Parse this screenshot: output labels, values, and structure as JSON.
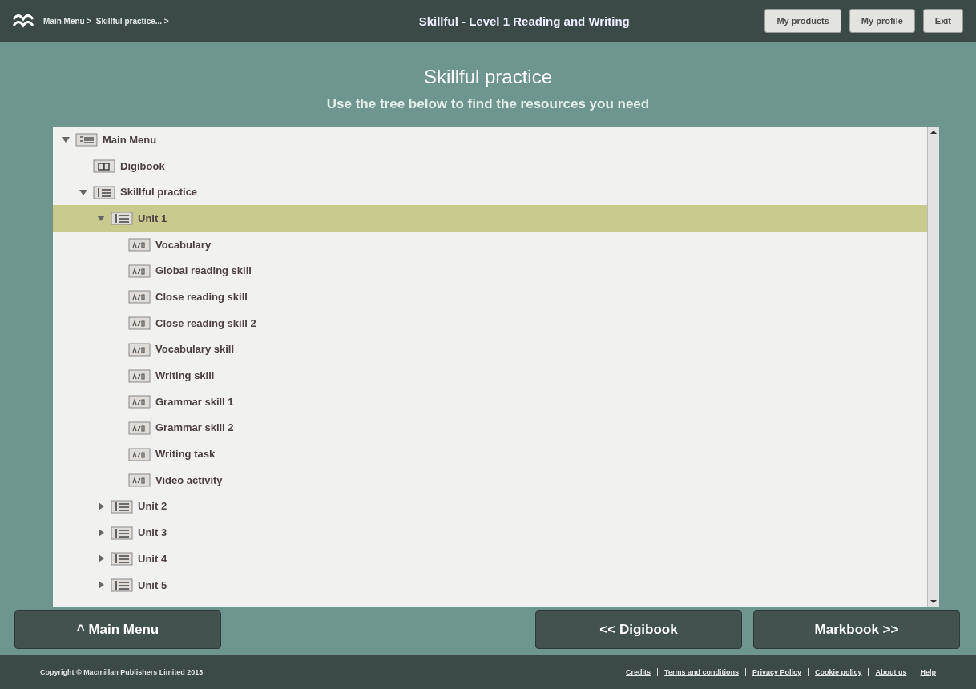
{
  "header": {
    "breadcrumb": "Main Menu >  Skillful practice... >",
    "title": "Skillful - Level 1 Reading and Writing",
    "buttons": [
      "My products",
      "My profile",
      "Exit"
    ]
  },
  "page": {
    "title": "Skillful practice",
    "subtitle": "Use the tree below to find the resources you need"
  },
  "tree": [
    {
      "label": "Main Menu",
      "kind": "menu",
      "expanded": true,
      "selected": false,
      "children": [
        {
          "label": "Digibook",
          "kind": "book",
          "selected": false
        },
        {
          "label": "Skillful practice",
          "kind": "list",
          "expanded": true,
          "selected": false,
          "children": [
            {
              "label": "Unit 1",
              "kind": "list",
              "expanded": true,
              "selected": true,
              "children": [
                {
                  "label": "Vocabulary",
                  "kind": "activity",
                  "selected": false
                },
                {
                  "label": "Global reading skill",
                  "kind": "activity",
                  "selected": false
                },
                {
                  "label": "Close reading skill",
                  "kind": "activity",
                  "selected": false
                },
                {
                  "label": "Close reading skill 2",
                  "kind": "activity",
                  "selected": false
                },
                {
                  "label": "Vocabulary skill",
                  "kind": "activity",
                  "selected": false
                },
                {
                  "label": "Writing skill",
                  "kind": "activity",
                  "selected": false
                },
                {
                  "label": "Grammar skill 1",
                  "kind": "activity",
                  "selected": false
                },
                {
                  "label": "Grammar skill 2",
                  "kind": "activity",
                  "selected": false
                },
                {
                  "label": "Writing task",
                  "kind": "activity",
                  "selected": false
                },
                {
                  "label": "Video activity",
                  "kind": "activity",
                  "selected": false
                }
              ]
            },
            {
              "label": "Unit 2",
              "kind": "list",
              "expanded": false,
              "selected": false
            },
            {
              "label": "Unit 3",
              "kind": "list",
              "expanded": false,
              "selected": false
            },
            {
              "label": "Unit 4",
              "kind": "list",
              "expanded": false,
              "selected": false
            },
            {
              "label": "Unit 5",
              "kind": "list",
              "expanded": false,
              "selected": false
            }
          ]
        }
      ]
    }
  ],
  "nav": {
    "back": "^ Main Menu",
    "prev": "<< Digibook",
    "next": "Markbook >>"
  },
  "footer": {
    "copyright": "Copyright © Macmillan Publishers Limited 2013",
    "links": [
      "Credits",
      "Terms and conditions",
      "Privacy Policy",
      "Cookie policy",
      "About us",
      "Help"
    ]
  }
}
